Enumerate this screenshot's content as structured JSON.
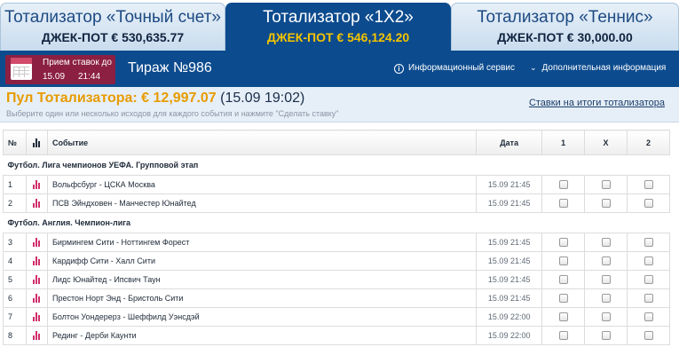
{
  "tabs": [
    {
      "title": "Тотализатор «Точный счет»",
      "jackpot": "ДЖЕК-ПОТ € 530,635.77",
      "active": false
    },
    {
      "title": "Тотализатор «1Х2»",
      "jackpot": "ДЖЕК-ПОТ € 546,124.20",
      "active": true
    },
    {
      "title": "Тотализатор «Теннис»",
      "jackpot": "ДЖЕК-ПОТ € 30,000.00",
      "active": false
    }
  ],
  "bar": {
    "bets_label": "Прием ставок до",
    "bets_date": "15.09",
    "bets_time": "21:44",
    "draw_title": "Тираж №986",
    "info_service": "Информационный сервис",
    "extra_info": "Дополнительная информация"
  },
  "pool": {
    "label": "Пул Тотализатора:",
    "amount": "€ 12,997.07",
    "date": "(15.09 19:02)",
    "hint": "Выберите один или несколько исходов для каждого события и нажмите \"Сделать ставку\"",
    "link": "Ставки на итоги тотализатора"
  },
  "table": {
    "headers": {
      "num": "№",
      "event": "Событие",
      "date": "Дата",
      "one": "1",
      "x": "X",
      "two": "2"
    },
    "groups": [
      {
        "title": "Футбол. Лига чемпионов УЕФА. Групповой этап",
        "rows": [
          {
            "num": "1",
            "event": "Вольфсбург - ЦСКА Москва",
            "date": "15.09 21:45"
          },
          {
            "num": "2",
            "event": "ПСВ Эйндховен - Манчестер Юнайтед",
            "date": "15.09 21:45"
          }
        ]
      },
      {
        "title": "Футбол. Англия. Чемпион-лига",
        "rows": [
          {
            "num": "3",
            "event": "Бирмингем Сити - Ноттингем Форест",
            "date": "15.09 21:45"
          },
          {
            "num": "4",
            "event": "Кардифф Сити - Халл Сити",
            "date": "15.09 21:45"
          },
          {
            "num": "5",
            "event": "Лидс Юнайтед - Ипсвич Таун",
            "date": "15.09 21:45"
          },
          {
            "num": "6",
            "event": "Престон Норт Энд - Бристоль Сити",
            "date": "15.09 21:45"
          },
          {
            "num": "7",
            "event": "Болтон Уондерерз - Шеффилд Уэнсдэй",
            "date": "15.09 22:00"
          },
          {
            "num": "8",
            "event": "Рединг - Дерби Каунти",
            "date": "15.09 22:00"
          }
        ]
      }
    ]
  },
  "colors": {
    "brand_blue": "#0c4b8e",
    "jackpot_yellow": "#f5c400",
    "pool_orange": "#e89b00",
    "calendar_maroon": "#8b2043",
    "stats_pink": "#d12f6b"
  },
  "icons": {
    "calendar": "calendar-icon",
    "info": "info-icon",
    "chevron": "chevron-down-icon",
    "stats": "bar-chart-icon"
  }
}
